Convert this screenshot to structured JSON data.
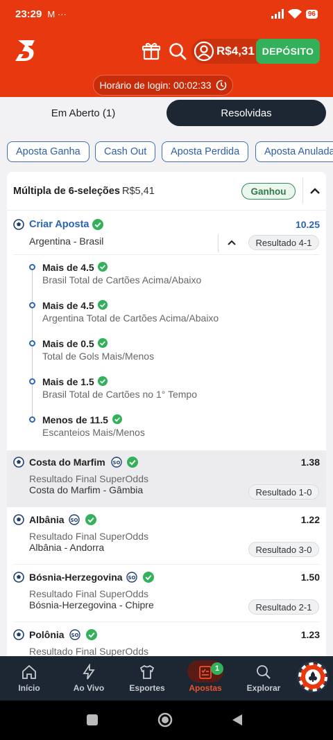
{
  "status_bar": {
    "time": "23:29",
    "notif": "M ···",
    "battery": "96"
  },
  "header": {
    "balance": "R$4,31",
    "deposit_label": "DEPÓSITO",
    "login_time": "Horário de login: 00:02:33"
  },
  "tabs": [
    {
      "label": "Em Aberto (1)",
      "active": false
    },
    {
      "label": "Resolvidas",
      "active": true
    }
  ],
  "filters": [
    "Aposta Ganha",
    "Cash Out",
    "Aposta Perdida",
    "Aposta Anulada"
  ],
  "bet": {
    "title": "Múltipla de 6-seleções",
    "amount": "R$5,41",
    "status": "Ganhou",
    "builder": {
      "title": "Criar Aposta",
      "odds": "10.25",
      "match": "Argentina - Brasil",
      "result": "Resultado 4-1",
      "legs": [
        {
          "title": "Mais de 4.5",
          "market": "Brasil Total de Cartões Acima/Abaixo"
        },
        {
          "title": "Mais de 4.5",
          "market": "Argentina Total de Cartões Acima/Abaixo"
        },
        {
          "title": "Mais de 0.5",
          "market": "Total de Gols Mais/Menos"
        },
        {
          "title": "Mais de 1.5",
          "market": "Brasil Total de Cartões no 1° Tempo"
        },
        {
          "title": "Menos de 11.5",
          "market": "Escanteios Mais/Menos"
        }
      ]
    },
    "selections": [
      {
        "team": "Costa do Marfim",
        "odds": "1.38",
        "market": "Resultado Final SuperOdds",
        "match": "Costa do Marfim - Gâmbia",
        "result": "Resultado 1-0"
      },
      {
        "team": "Albânia",
        "odds": "1.22",
        "market": "Resultado Final SuperOdds",
        "match": "Albânia - Andorra",
        "result": "Resultado 3-0"
      },
      {
        "team": "Bósnia-Herzegovina",
        "odds": "1.50",
        "market": "Resultado Final SuperOdds",
        "match": "Bósnia-Herzegovina - Chipre",
        "result": "Resultado 2-1"
      },
      {
        "team": "Polônia",
        "odds": "1.23",
        "market": "Resultado Final SuperOdds",
        "match": "",
        "result": ""
      }
    ]
  },
  "bottom_nav": [
    {
      "label": "Início",
      "icon": "home-icon"
    },
    {
      "label": "Ao Vivo",
      "icon": "lightning-icon"
    },
    {
      "label": "Esportes",
      "icon": "shirt-icon"
    },
    {
      "label": "Apostas",
      "icon": "betslip-icon",
      "active": true,
      "badge": "1"
    },
    {
      "label": "Explorar",
      "icon": "search-icon"
    }
  ],
  "colors": {
    "brand": "#e8380f",
    "nav": "#1d2733",
    "success": "#32b15a",
    "link": "#2a64b3"
  }
}
